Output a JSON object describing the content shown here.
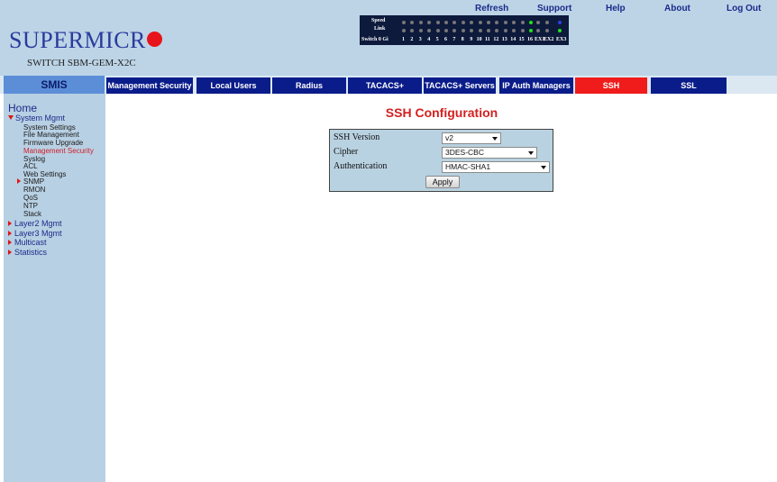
{
  "header": {
    "brand": "SUPERMICR",
    "switch_model": "SWITCH SBM-GEM-X2C",
    "links": {
      "refresh": "Refresh",
      "support": "Support",
      "help": "Help",
      "about": "About",
      "logout": "Log Out"
    }
  },
  "port_panel": {
    "speed_label": "Speed",
    "link_label": "Link",
    "switch_label": "Switch 0 Gi",
    "ports": [
      "1",
      "2",
      "3",
      "4",
      "5",
      "6",
      "7",
      "8",
      "9",
      "10",
      "11",
      "12",
      "13",
      "14",
      "15",
      "16",
      "EX1",
      "EX2",
      "EX3"
    ],
    "speed_states": [
      "off",
      "off",
      "off",
      "off",
      "off",
      "off",
      "off",
      "off",
      "off",
      "off",
      "off",
      "off",
      "off",
      "off",
      "off",
      "green",
      "off",
      "off",
      "blue"
    ],
    "link_states": [
      "off",
      "off",
      "off",
      "off",
      "off",
      "off",
      "off",
      "off",
      "off",
      "off",
      "off",
      "off",
      "off",
      "off",
      "off",
      "green",
      "off",
      "off",
      "green"
    ],
    "colors": {
      "off": "#777777",
      "green": "#22e11a",
      "blue": "#2f3fe0"
    }
  },
  "nav": {
    "smis": "SMIS",
    "tabs": [
      {
        "label": "Management Security",
        "active": false
      },
      {
        "label": "Local Users",
        "active": false
      },
      {
        "label": "Radius",
        "active": false
      },
      {
        "label": "TACACS+",
        "active": false
      },
      {
        "label": "TACACS+ Servers",
        "active": false
      },
      {
        "label": "IP Auth Managers",
        "active": false
      },
      {
        "label": "SSH",
        "active": true
      },
      {
        "label": "SSL",
        "active": false
      }
    ]
  },
  "sidebar": {
    "home": "Home",
    "system_mgmt": "System Mgmt",
    "system_items": [
      "System Settings",
      "File Management",
      "Firmware Upgrade",
      "Management Security",
      "Syslog",
      "ACL",
      "Web Settings"
    ],
    "snmp": "SNMP",
    "more_items": [
      "RMON",
      "QoS",
      "NTP",
      "Stack"
    ],
    "groups": [
      "Layer2 Mgmt",
      "Layer3 Mgmt",
      "Multicast",
      "Statistics"
    ]
  },
  "main": {
    "title": "SSH Configuration",
    "fields": {
      "ssh_version": {
        "label": "SSH Version",
        "value": "v2"
      },
      "cipher": {
        "label": "Cipher",
        "value": "3DES-CBC"
      },
      "authentication": {
        "label": "Authentication",
        "value": "HMAC-SHA1"
      }
    },
    "apply": "Apply"
  },
  "colors": {
    "header_bg": "#bcd4e6",
    "sidebar_bg": "#b8d0e3",
    "tab_bg": "#0a1c8a",
    "tab_active_bg": "#f01c1c",
    "title_red": "#d41f1f",
    "link_blue": "#1c2a8a"
  }
}
